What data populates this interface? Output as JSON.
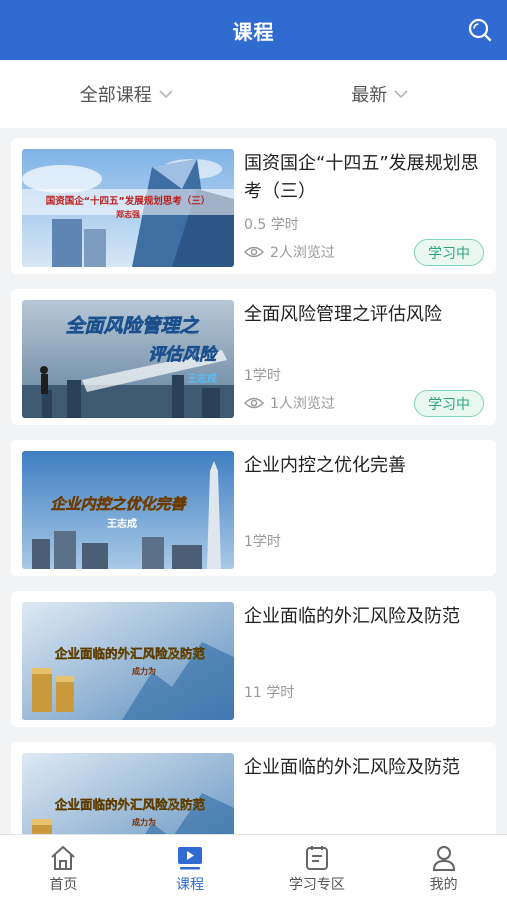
{
  "header": {
    "title": "课程",
    "search_icon": "search-icon"
  },
  "filters": {
    "category_label": "全部课程",
    "sort_label": "最新"
  },
  "courses": [
    {
      "title": "国资国企“十四五”发展规划思考（三）",
      "thumb_text": "国资国企“十四五”发展规划思考（三）",
      "thumb_sub": "郑志强",
      "hours": "0.5 学时",
      "views": "2人浏览过",
      "badge": "学习中"
    },
    {
      "title": "全面风险管理之评估风险",
      "thumb_text": "全面风险管理之",
      "thumb_text2": "评估风险",
      "thumb_sub": "王志成",
      "hours": "1学时",
      "views": "1人浏览过",
      "badge": "学习中"
    },
    {
      "title": "企业内控之优化完善",
      "thumb_text": "企业内控之优化完善",
      "thumb_sub": "王志成",
      "hours": "1学时"
    },
    {
      "title": "企业面临的外汇风险及防范",
      "thumb_text": "企业面临的外汇风险及防范",
      "thumb_sub": "成力为",
      "hours": "11 学时"
    },
    {
      "title": "企业面临的外汇风险及防范",
      "thumb_text": "企业面临的外汇风险及防范",
      "thumb_sub": "成力为"
    }
  ],
  "tabs": [
    {
      "label": "首页",
      "icon": "home-icon"
    },
    {
      "label": "课程",
      "icon": "course-play-icon"
    },
    {
      "label": "学习专区",
      "icon": "study-zone-icon"
    },
    {
      "label": "我的",
      "icon": "profile-icon"
    }
  ],
  "colors": {
    "brand": "#2f6bd1",
    "badge_green": "#2fa47c",
    "background": "#f2f3f5"
  }
}
